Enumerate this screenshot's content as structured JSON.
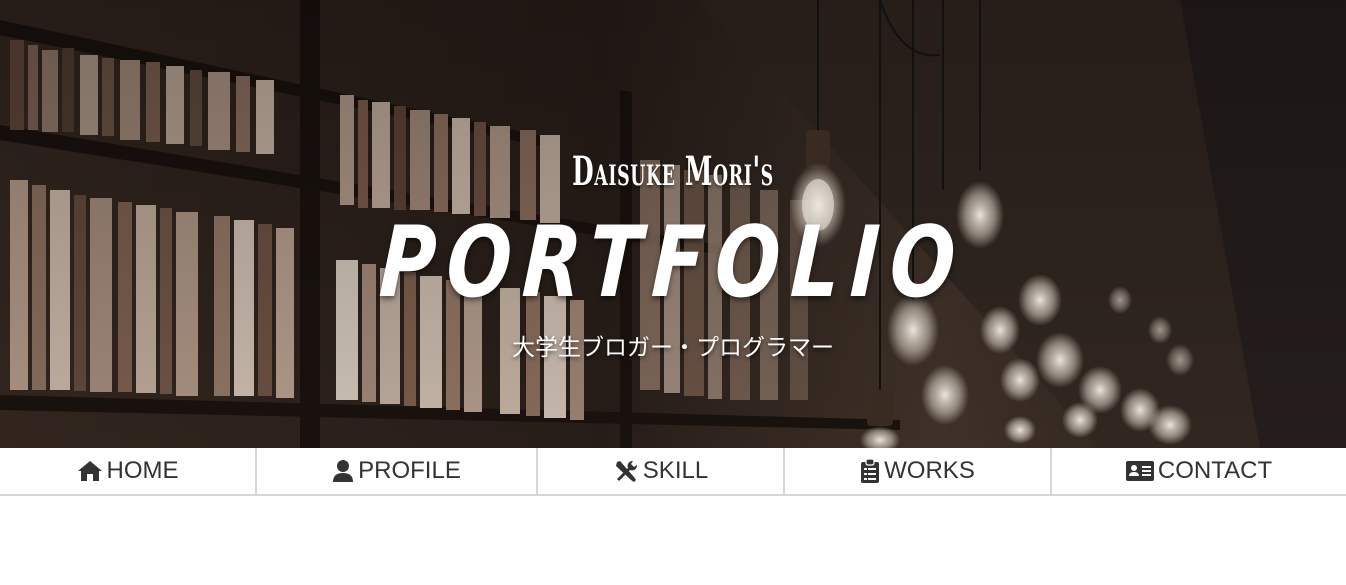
{
  "hero": {
    "subtitle": "Daisuke Mori's",
    "title": "PORTFOLIO",
    "tagline": "大学生ブロガー・プログラマー"
  },
  "nav": {
    "items": [
      {
        "label": "HOME",
        "icon": "home-icon"
      },
      {
        "label": "PROFILE",
        "icon": "user-icon"
      },
      {
        "label": "SKILL",
        "icon": "tools-icon"
      },
      {
        "label": "WORKS",
        "icon": "clipboard-icon"
      },
      {
        "label": "CONTACT",
        "icon": "id-card-icon"
      }
    ]
  },
  "colors": {
    "nav_text": "#333333",
    "nav_border": "#d6d6d6",
    "hero_text": "#ffffff"
  }
}
